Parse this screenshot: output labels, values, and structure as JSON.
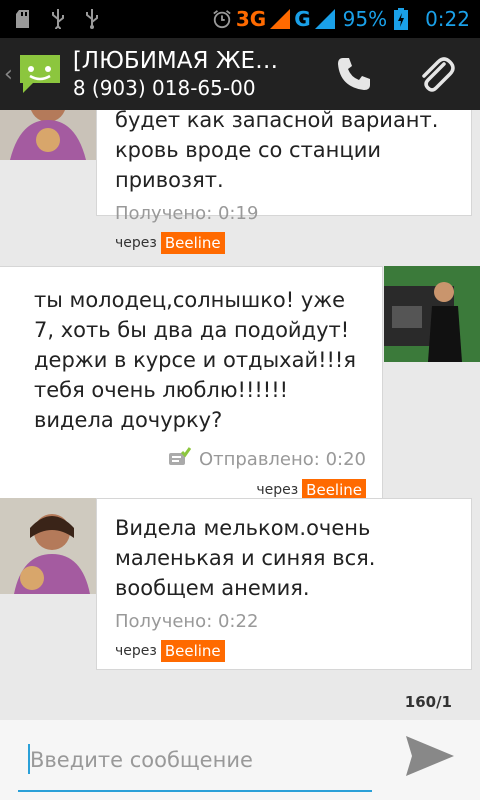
{
  "status_bar": {
    "network_3g": "3G",
    "network_g": "G",
    "battery": "95%",
    "time": "0:22"
  },
  "header": {
    "title": "[ЛЮБИМАЯ ЖЕ…",
    "subtitle": "8 (903) 018-65-00"
  },
  "messages": [
    {
      "direction": "incoming",
      "text": "будет как запасной вариант. кровь вроде со станции привозят.",
      "status": "Получено: 0:19",
      "via_label": "через",
      "carrier": "Beeline"
    },
    {
      "direction": "outgoing",
      "text": "ты молодец,солнышко! уже 7, хоть бы два да подойдут! держи в курсе и отдыхай!!!я тебя очень люблю!!!!!! видела дочурку?",
      "status": "Отправлено: 0:20",
      "via_label": "через",
      "carrier": "Beeline"
    },
    {
      "direction": "incoming",
      "text": "Видела мельком.очень маленькая и синяя вся. вообщем анемия.",
      "status": "Получено: 0:22",
      "via_label": "через",
      "carrier": "Beeline"
    }
  ],
  "compose": {
    "counter": "160/1",
    "placeholder": "Введите сообщение"
  },
  "colors": {
    "accent": "#2aa0d8",
    "carrier_badge": "#ff6a00"
  }
}
